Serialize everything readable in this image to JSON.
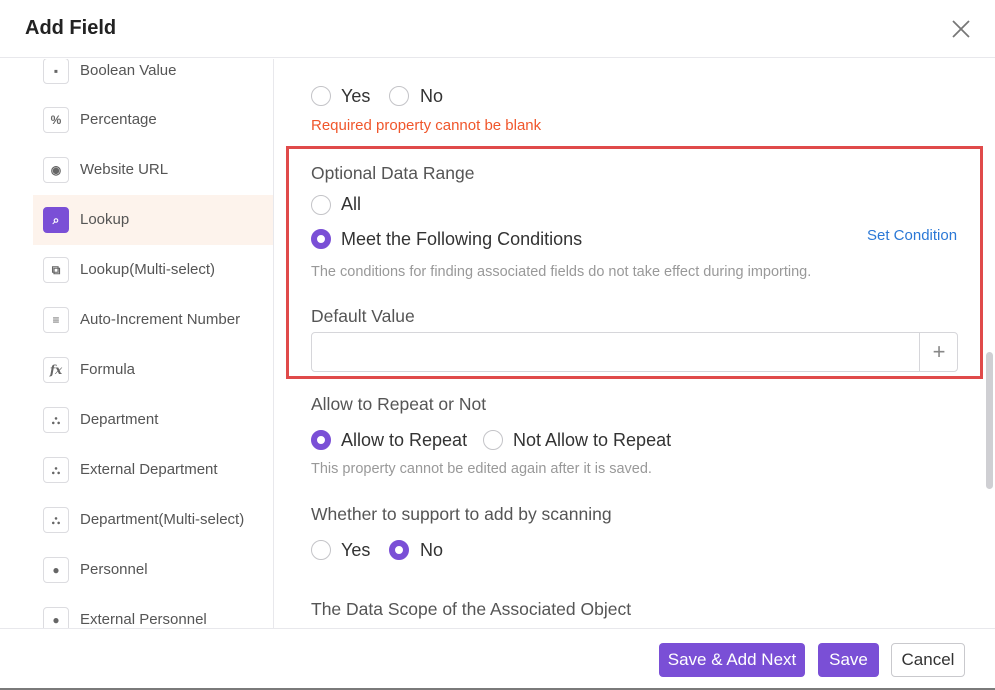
{
  "dialog": {
    "title": "Add Field"
  },
  "sidebar": {
    "items": [
      {
        "label": "Boolean Value",
        "icon": "boolean-icon",
        "glyph": "▪",
        "active": false
      },
      {
        "label": "Percentage",
        "icon": "percent-icon",
        "glyph": "%",
        "active": false
      },
      {
        "label": "Website URL",
        "icon": "globe-icon",
        "glyph": "◉",
        "active": false
      },
      {
        "label": "Lookup",
        "icon": "lookup-icon",
        "glyph": "⌕",
        "active": true
      },
      {
        "label": "Lookup(Multi-select)",
        "icon": "lookup-multi-icon",
        "glyph": "⧉",
        "active": false
      },
      {
        "label": "Auto-Increment Number",
        "icon": "list-icon",
        "glyph": "≡",
        "active": false
      },
      {
        "label": "Formula",
        "icon": "formula-icon",
        "glyph": "fx",
        "active": false
      },
      {
        "label": "Department",
        "icon": "department-icon",
        "glyph": "⛬",
        "active": false
      },
      {
        "label": "External Department",
        "icon": "external-department-icon",
        "glyph": "⛬",
        "active": false
      },
      {
        "label": "Department(Multi-select)",
        "icon": "department-multi-icon",
        "glyph": "⛬",
        "active": false
      },
      {
        "label": "Personnel",
        "icon": "person-icon",
        "glyph": "●",
        "active": false
      },
      {
        "label": "External Personnel",
        "icon": "external-person-icon",
        "glyph": "●",
        "active": false
      }
    ]
  },
  "main": {
    "required": {
      "yes": "Yes",
      "no": "No",
      "error": "Required property cannot be blank"
    },
    "range": {
      "label": "Optional Data Range",
      "all": "All",
      "meet": "Meet the Following Conditions",
      "set_condition": "Set Condition",
      "hint": "The conditions for finding associated fields do not take effect during importing."
    },
    "default_value": {
      "label": "Default Value",
      "value": "",
      "add": "+"
    },
    "repeat": {
      "label": "Allow to Repeat or Not",
      "allow": "Allow to Repeat",
      "not_allow": "Not Allow to Repeat",
      "hint": "This property cannot be edited again after it is saved."
    },
    "scan": {
      "label": "Whether to support to add by scanning",
      "yes": "Yes",
      "no": "No"
    },
    "scope": {
      "label": "The Data Scope of the Associated Object"
    }
  },
  "footer": {
    "save_add_next": "Save & Add Next",
    "save": "Save",
    "cancel": "Cancel"
  },
  "colors": {
    "accent": "#7a4fd6",
    "error": "#f0562b",
    "link": "#2b78d6",
    "highlight": "#e04a4a"
  }
}
